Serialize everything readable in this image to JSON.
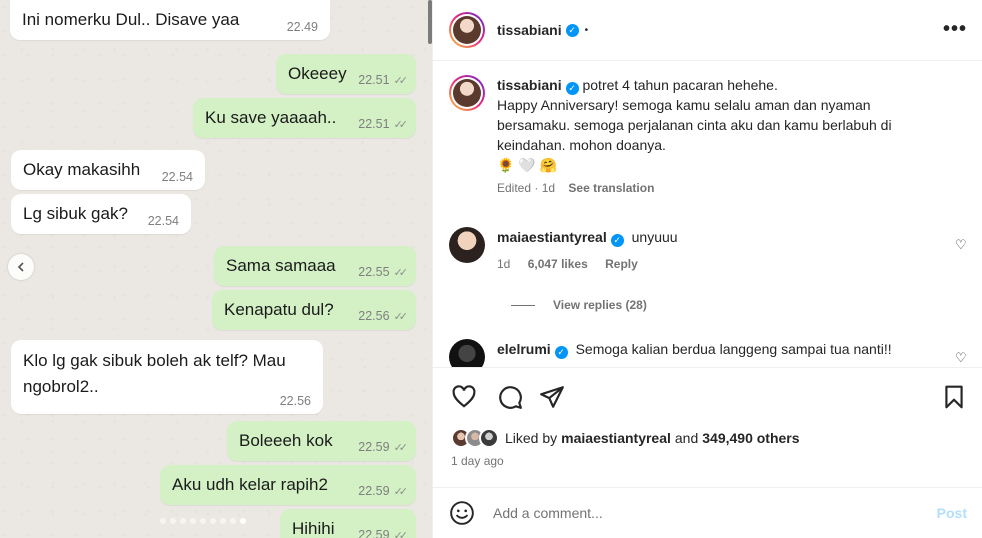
{
  "chat": {
    "messages": [
      {
        "text": "Ini nomerku Dul.. Disave yaa",
        "time": "22.49",
        "side": "in"
      },
      {
        "text": "Okeeey",
        "time": "22.51",
        "side": "out"
      },
      {
        "text": "Ku save yaaaah..",
        "time": "22.51",
        "side": "out"
      },
      {
        "text": "Okay makasihh",
        "time": "22.54",
        "side": "in"
      },
      {
        "text": "Lg sibuk gak?",
        "time": "22.54",
        "side": "in"
      },
      {
        "text": "Sama samaaa",
        "time": "22.55",
        "side": "out"
      },
      {
        "text": "Kenapatu dul?",
        "time": "22.56",
        "side": "out"
      },
      {
        "text": "Klo lg gak sibuk boleh ak telf? Mau ngobrol2..",
        "time": "22.56",
        "side": "in"
      },
      {
        "text": "Boleeeh kok",
        "time": "22.59",
        "side": "out"
      },
      {
        "text": "Aku udh kelar rapih2",
        "time": "22.59",
        "side": "out"
      },
      {
        "text": "Hihihi",
        "time": "22.59",
        "side": "out"
      }
    ],
    "carousel_count": 9,
    "carousel_active": 8
  },
  "header": {
    "username": "tissabiani",
    "more": "•••",
    "dot": "•"
  },
  "caption": {
    "username": "tissabiani",
    "text": "potret 4 tahun pacaran hehehe.",
    "body": "Happy Anniversary! semoga kamu selalu aman dan nyaman bersamaku. semoga perjalanan cinta aku dan kamu berlabuh di keindahan. mohon doanya.",
    "emojis": "🌻 🤍 🤗",
    "edited": "Edited · 1d",
    "see_translation": "See translation"
  },
  "comments": [
    {
      "username": "maiaestiantyreal",
      "text": "unyuuu",
      "age": "1d",
      "likes": "6,047 likes",
      "reply": "Reply",
      "view_replies": "View replies (28)"
    },
    {
      "username": "elelrumi",
      "text": "Semoga kalian berdua langgeng sampai tua nanti!!"
    }
  ],
  "likes": {
    "prefix": "Liked by",
    "user": "maiaestiantyreal",
    "and": "and",
    "others": "349,490 others"
  },
  "post_time": "1 day ago",
  "add_comment": {
    "placeholder": "Add a comment...",
    "post": "Post"
  }
}
